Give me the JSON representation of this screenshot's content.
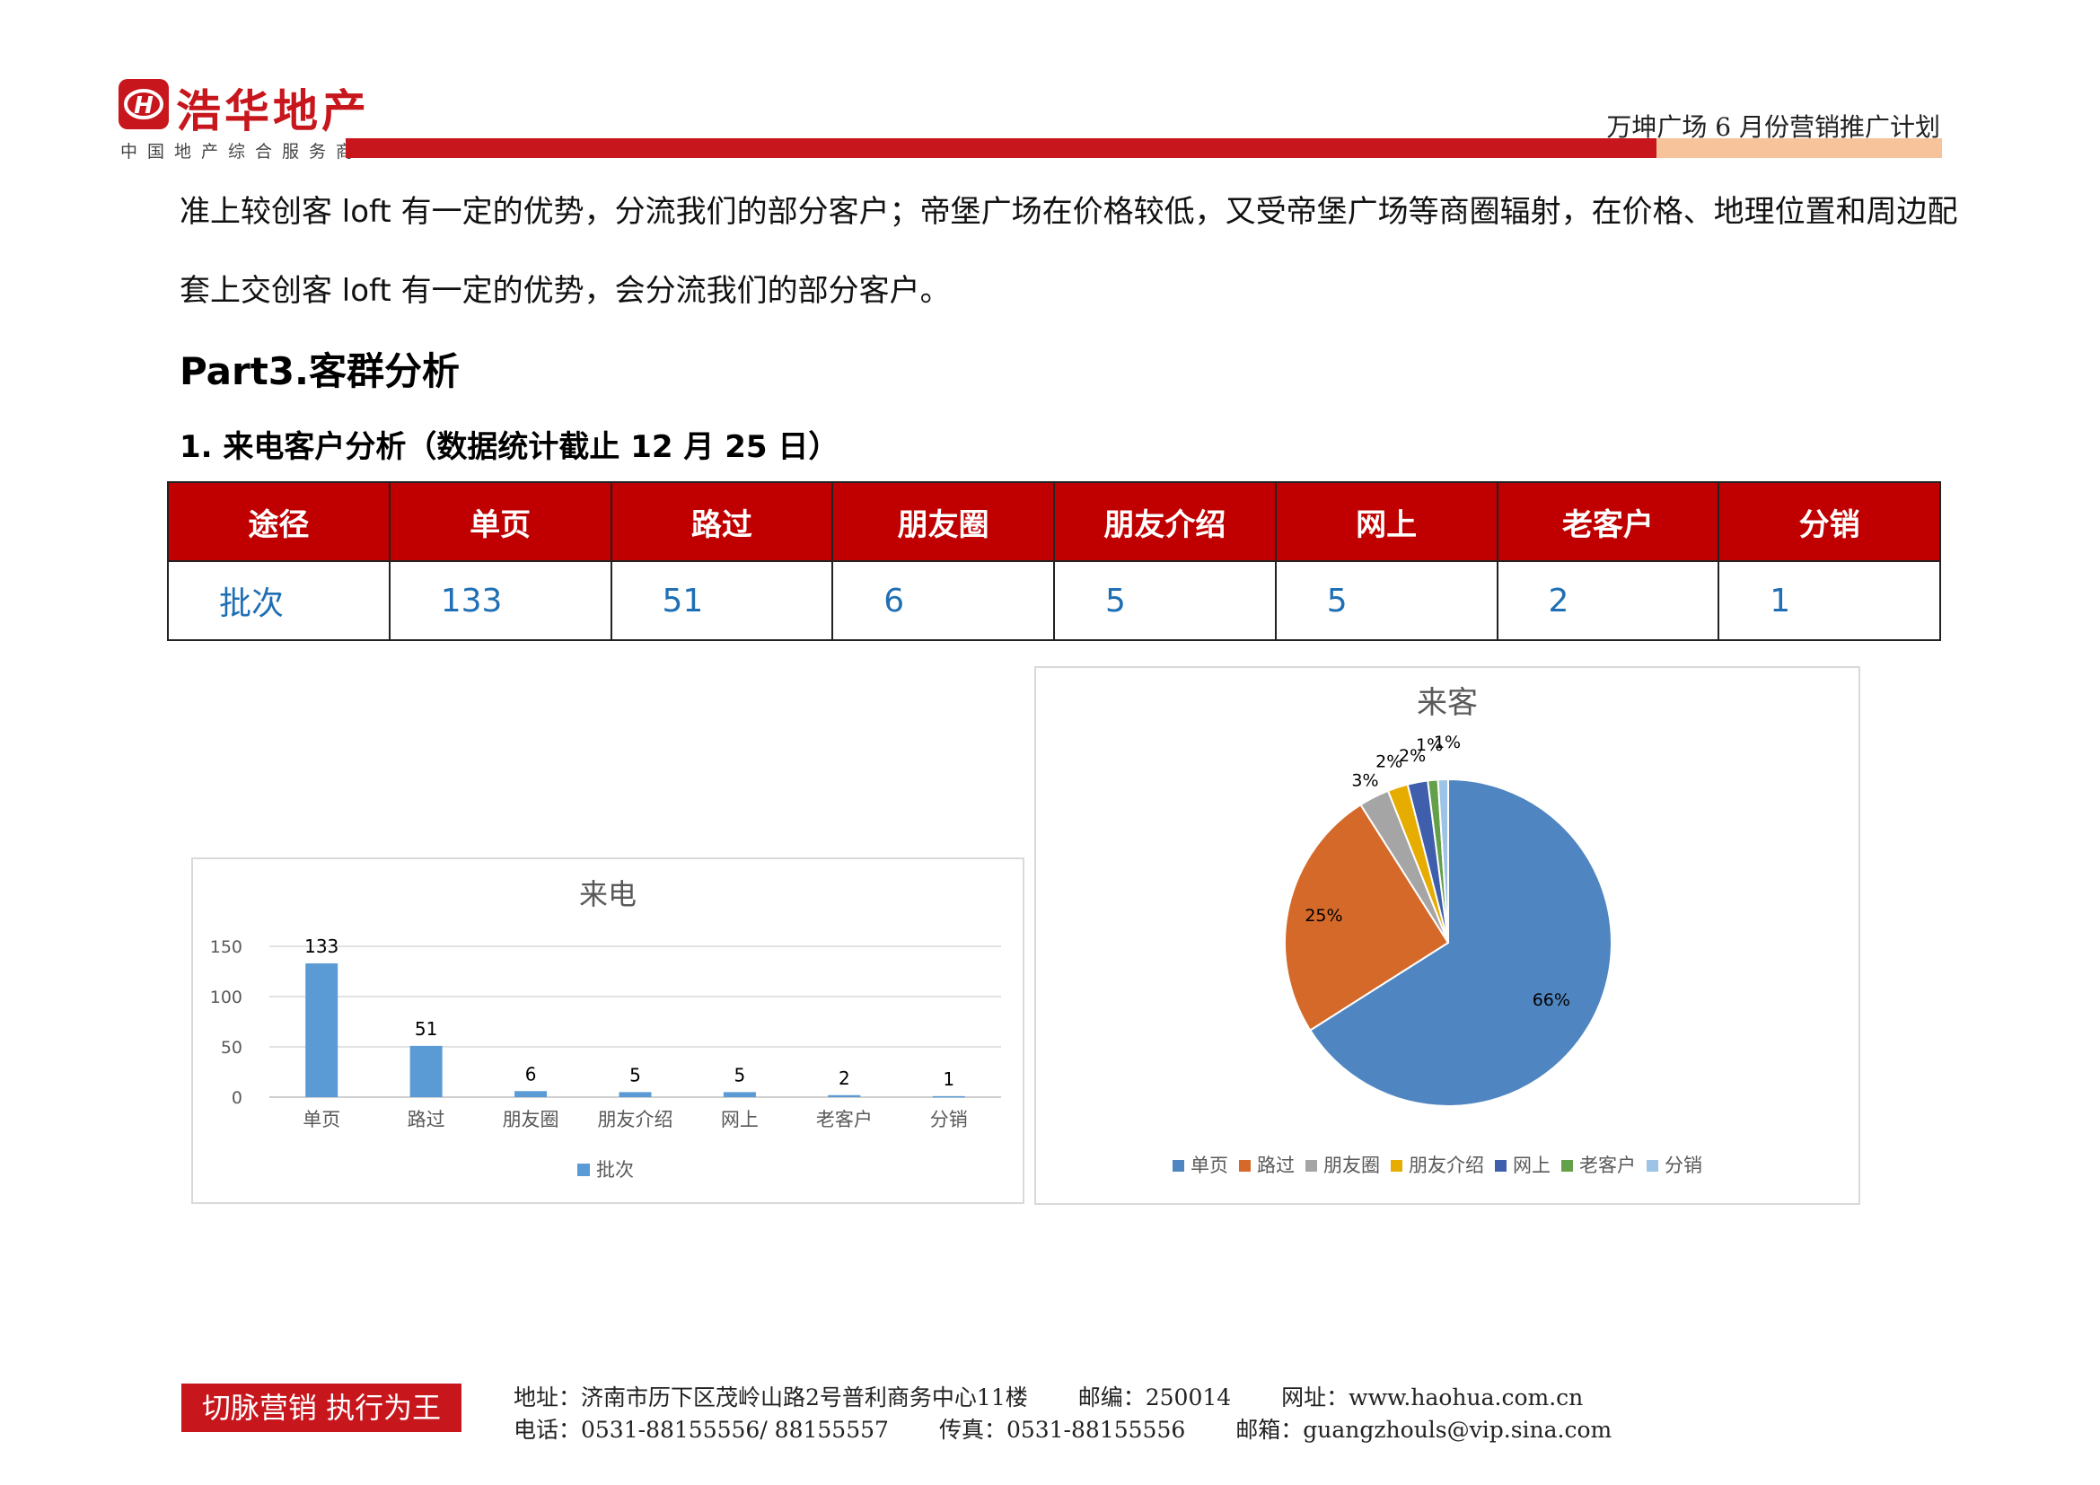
{
  "header": {
    "logo_name": "浩华地产",
    "logo_tagline": "中国地产综合服务商",
    "document_title": "万坤广场 6 月份营销推广计划"
  },
  "body": {
    "para1": "准上较创客 loft 有一定的优势，分流我们的部分客户；帝堡广场在价格较低，又受帝堡广场等商圈辐射，在价格、地理位置和周边配",
    "para2": "套上交创客 loft 有一定的优势，会分流我们的部分客户。",
    "section_title": "Part3.客群分析",
    "sub_title": "1. 来电客户分析（数据统计截止 12 月 25 日）"
  },
  "table": {
    "headers": [
      "途径",
      "单页",
      "路过",
      "朋友圈",
      "朋友介绍",
      "网上",
      "老客户",
      "分销"
    ],
    "row": [
      "批次",
      "133",
      "51",
      "6",
      "5",
      "5",
      "2",
      "1"
    ]
  },
  "chart_data": [
    {
      "type": "bar",
      "title": "来电",
      "categories": [
        "单页",
        "路过",
        "朋友圈",
        "朋友介绍",
        "网上",
        "老客户",
        "分销"
      ],
      "series": [
        {
          "name": "批次",
          "values": [
            133,
            51,
            6,
            5,
            5,
            2,
            1
          ]
        }
      ],
      "ylim": [
        0,
        150
      ],
      "yticks": [
        0,
        50,
        100,
        150
      ],
      "grid": true,
      "legend": "bottom",
      "color": "#5b9bd5"
    },
    {
      "type": "pie",
      "title": "来客",
      "labels": [
        "单页",
        "路过",
        "朋友圈",
        "朋友介绍",
        "网上",
        "老客户",
        "分销"
      ],
      "values": [
        66,
        25,
        3,
        2,
        2,
        1,
        1
      ],
      "value_labels": [
        "66%",
        "25%",
        "3%",
        "2%",
        "2%",
        "1%",
        "1%"
      ],
      "colors": [
        "#4f86c1",
        "#d4692a",
        "#a5a5a5",
        "#e6ad00",
        "#3f5fac",
        "#64a04a",
        "#9dc3e6"
      ],
      "legend": "bottom"
    }
  ],
  "footer": {
    "slogan": "切脉营销 执行为王",
    "address": "地址：济南市历下区茂岭山路2号普利商务中心11楼",
    "postcode": "邮编：250014",
    "website": "网址：www.haohua.com.cn",
    "phone": "电话：0531-88155556/ 88155557",
    "fax": "传真：0531-88155556",
    "email": "邮箱：guangzhouls@vip.sina.com"
  }
}
